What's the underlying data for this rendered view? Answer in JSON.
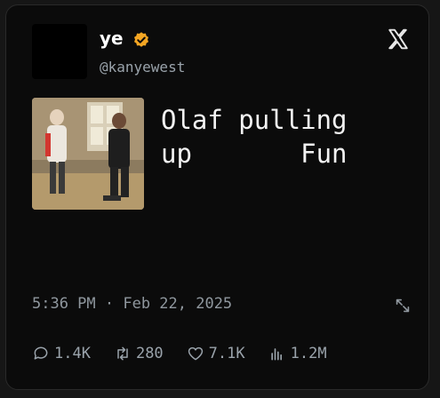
{
  "author": {
    "name": "ye",
    "handle": "@kanyewest",
    "verified_color": "#f5a623"
  },
  "icons": [
    "verified-badge-icon",
    "x-logo-icon",
    "expand-icon",
    "reply-icon",
    "retweet-icon",
    "like-icon",
    "views-icon"
  ],
  "tweet": {
    "text": "Olaf pulling\nup       Fun",
    "media_alt": "photo of two people standing in a room"
  },
  "meta": {
    "timestamp": "5:36 PM · Feb 22, 2025"
  },
  "stats": {
    "replies": "1.4K",
    "retweets": "280",
    "likes": "7.1K",
    "views": "1.2M"
  }
}
